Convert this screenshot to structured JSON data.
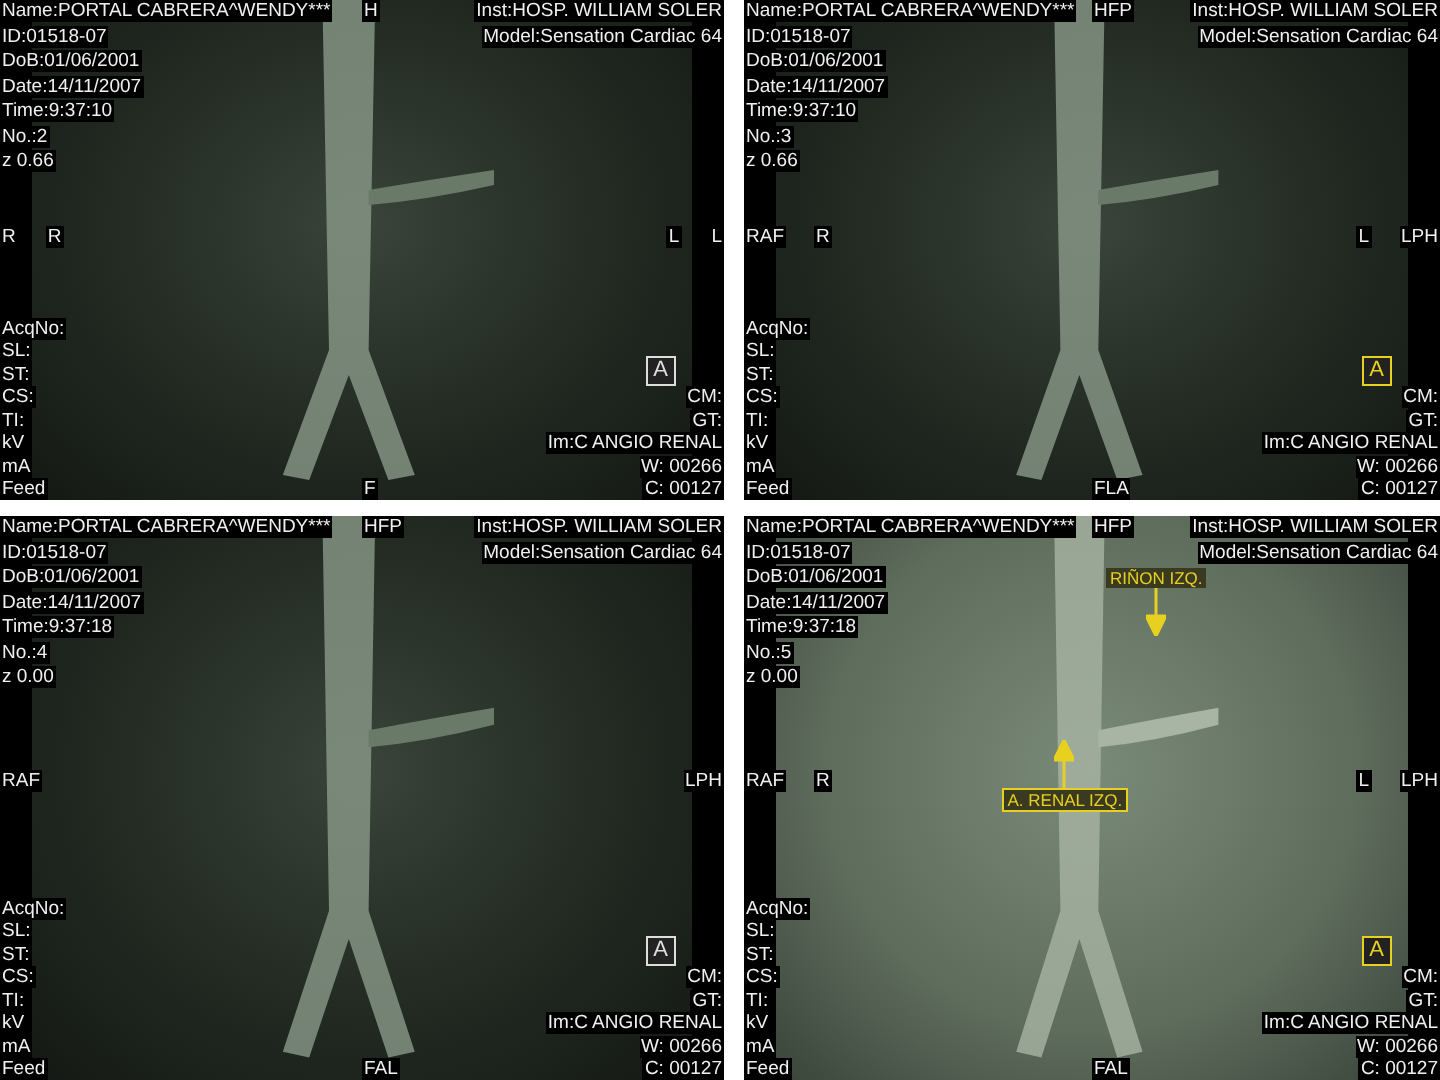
{
  "panels": [
    {
      "kind": "plain",
      "top_left": [
        "Name:PORTAL CABRERA^WENDY***",
        "ID:01518-07",
        "DoB:01/06/2001",
        "Date:14/11/2007",
        "Time:9:37:10",
        "No.:2",
        "z 0.66"
      ],
      "top_center": "H",
      "top_right": [
        "Inst:HOSP. WILLIAM SOLER",
        "Model:Sensation Cardiac 64"
      ],
      "left_markers": [
        "R",
        "R"
      ],
      "right_markers": [
        "L",
        "L"
      ],
      "bottom_left": [
        "AcqNo:",
        "SL:",
        "ST:",
        "CS:",
        "TI:",
        "kV",
        "mA",
        "Feed"
      ],
      "bottom_right": [
        "CM:",
        "GT:",
        "Im:C ANGIO RENAL",
        "W: 00266",
        "C: 00127"
      ],
      "badge": "A",
      "badge_active": false,
      "bottom_center": "F"
    },
    {
      "kind": "plain",
      "top_left": [
        "Name:PORTAL CABRERA^WENDY***",
        "ID:01518-07",
        "DoB:01/06/2001",
        "Date:14/11/2007",
        "Time:9:37:10",
        "No.:3",
        "z 0.66"
      ],
      "top_center": "HFP",
      "top_right": [
        "Inst:HOSP. WILLIAM SOLER",
        "Model:Sensation Cardiac 64"
      ],
      "left_markers": [
        "RAF",
        "R"
      ],
      "right_markers": [
        "L",
        "LPH"
      ],
      "bottom_left": [
        "AcqNo:",
        "SL:",
        "ST:",
        "CS:",
        "TI:",
        "kV",
        "mA",
        "Feed"
      ],
      "bottom_right": [
        "CM:",
        "GT:",
        "Im:C ANGIO RENAL",
        "W: 00266",
        "C: 00127"
      ],
      "badge": "A",
      "badge_active": true,
      "bottom_center": "FLA"
    },
    {
      "kind": "plain",
      "top_left": [
        "Name:PORTAL CABRERA^WENDY***",
        "ID:01518-07",
        "DoB:01/06/2001",
        "Date:14/11/2007",
        "Time:9:37:18",
        "No.:4",
        "z 0.00"
      ],
      "top_center": "HFP",
      "top_right": [
        "Inst:HOSP. WILLIAM SOLER",
        "Model:Sensation Cardiac 64"
      ],
      "left_markers": [
        "RAF"
      ],
      "right_markers": [
        "LPH"
      ],
      "bottom_left": [
        "AcqNo:",
        "SL:",
        "ST:",
        "CS:",
        "TI:",
        "kV",
        "mA",
        "Feed"
      ],
      "bottom_right": [
        "CM:",
        "GT:",
        "Im:C ANGIO RENAL",
        "W: 00266",
        "C: 00127"
      ],
      "badge": "A",
      "badge_active": false,
      "bottom_center": "FAL"
    },
    {
      "kind": "enhanced",
      "top_left": [
        "Name:PORTAL CABRERA^WENDY***",
        "ID:01518-07",
        "DoB:01/06/2001",
        "Date:14/11/2007",
        "Time:9:37:18",
        "No.:5",
        "z 0.00"
      ],
      "top_center": "HFP",
      "top_right": [
        "Inst:HOSP. WILLIAM SOLER",
        "Model:Sensation Cardiac 64"
      ],
      "left_markers": [
        "RAF",
        "R"
      ],
      "right_markers": [
        "L",
        "LPH"
      ],
      "bottom_left": [
        "AcqNo:",
        "SL:",
        "ST:",
        "CS:",
        "TI:",
        "kV",
        "mA",
        "Feed"
      ],
      "bottom_right": [
        "CM:",
        "GT:",
        "Im:C ANGIO RENAL",
        "W: 00266",
        "C: 00127"
      ],
      "badge": "A",
      "badge_active": true,
      "bottom_center": "FAL",
      "annotations": [
        {
          "kind": "arrow_down",
          "label": "RIÑON IZQ."
        },
        {
          "kind": "arrow_up",
          "label": "A. RENAL IZQ."
        }
      ]
    }
  ]
}
